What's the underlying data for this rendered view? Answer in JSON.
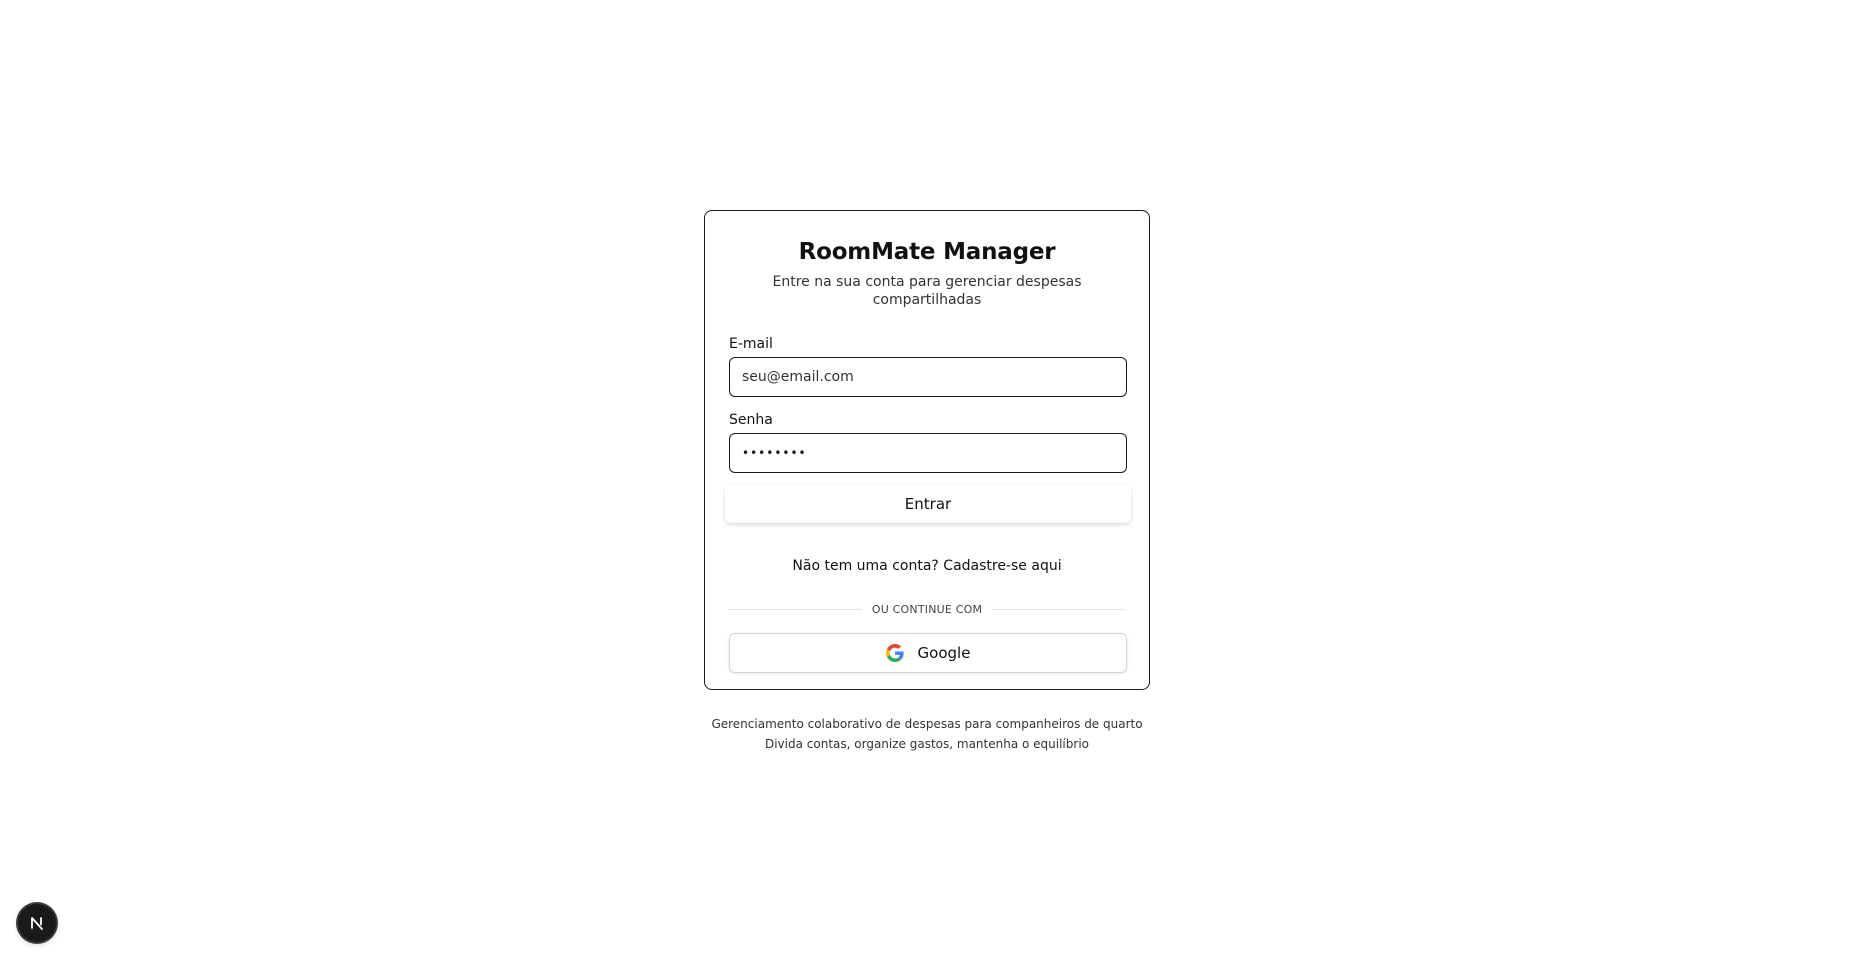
{
  "app": {
    "title": "RoomMate Manager",
    "subtitle": "Entre na sua conta para gerenciar despesas compartilhadas"
  },
  "form": {
    "email": {
      "label": "E-mail",
      "placeholder": "seu@email.com"
    },
    "password": {
      "label": "Senha",
      "value": "••••••••"
    },
    "submit_label": "Entrar"
  },
  "signup_text": "Não tem uma conta? Cadastre-se aqui",
  "divider_text": "OU CONTINUE COM",
  "google_button": {
    "label": "Google",
    "icon": "google-icon"
  },
  "footer": {
    "line1": "Gerenciamento colaborativo de despesas para companheiros de quarto",
    "line2": "Divida contas, organize gastos, mantenha o equilíbrio"
  },
  "dev_badge": {
    "icon": "nextjs-icon"
  },
  "colors": {
    "border": "#1a1a1a",
    "background": "#ffffff",
    "badge": "#1a1a1a"
  }
}
